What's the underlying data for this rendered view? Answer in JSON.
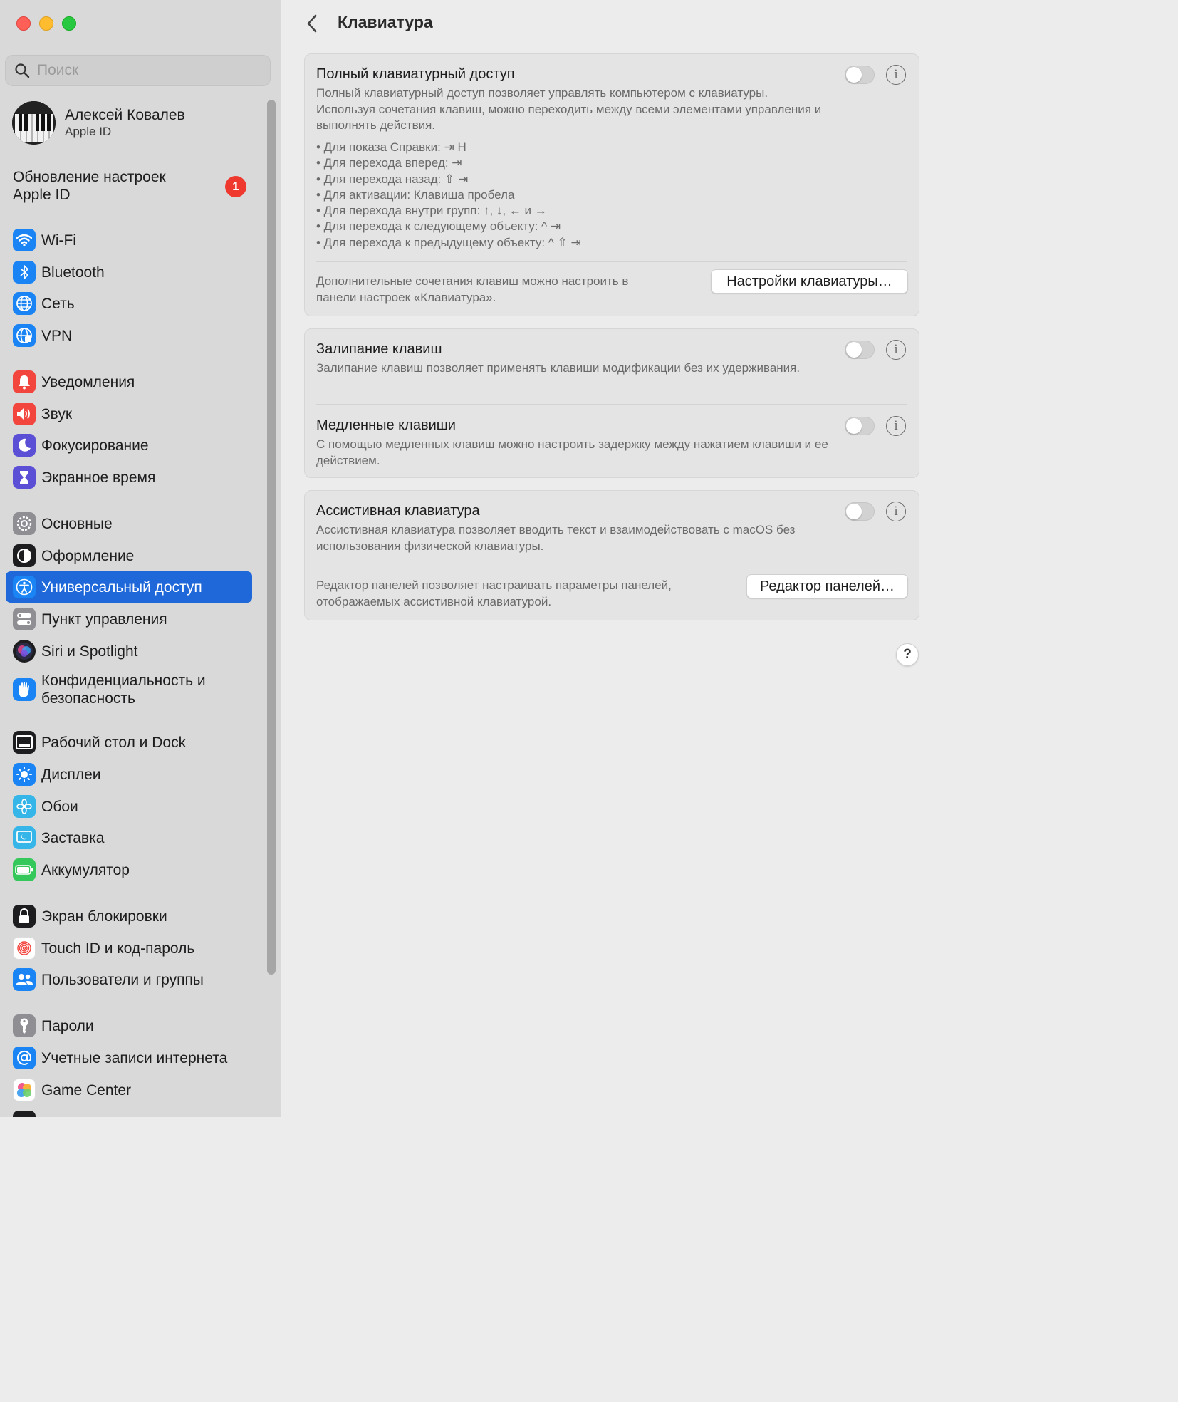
{
  "window": {
    "controls": [
      "close",
      "minimize",
      "maximize"
    ]
  },
  "sidebar": {
    "search_placeholder": "Поиск",
    "user": {
      "name": "Алексей Ковалев",
      "subtitle": "Apple ID"
    },
    "update": {
      "label": "Обновление настроек Apple ID",
      "badge": "1"
    },
    "items": [
      {
        "label": "Wi-Fi",
        "icon": "wifi-icon",
        "color": "#1a84f5"
      },
      {
        "label": "Bluetooth",
        "icon": "bluetooth-icon",
        "color": "#1a84f5"
      },
      {
        "label": "Сеть",
        "icon": "globe-icon",
        "color": "#1a84f5"
      },
      {
        "label": "VPN",
        "icon": "vpn-globe-icon",
        "color": "#1a84f5"
      },
      {
        "label": "Уведомления",
        "icon": "bell-icon",
        "color": "#f2453d"
      },
      {
        "label": "Звук",
        "icon": "speaker-icon",
        "color": "#f2453d"
      },
      {
        "label": "Фокусирование",
        "icon": "moon-icon",
        "color": "#5b4fd6"
      },
      {
        "label": "Экранное время",
        "icon": "hourglass-icon",
        "color": "#5b4fd6"
      },
      {
        "label": "Основные",
        "icon": "gear-icon",
        "color": "#8e8e93"
      },
      {
        "label": "Оформление",
        "icon": "appearance-icon",
        "color": "#1d1d1f"
      },
      {
        "label": "Универсальный доступ",
        "icon": "accessibility-icon",
        "color": "#1a84f5",
        "selected": true
      },
      {
        "label": "Пункт управления",
        "icon": "control-center-icon",
        "color": "#8e8e93"
      },
      {
        "label": "Siri и Spotlight",
        "icon": "siri-icon",
        "color": "#7b3fc4"
      },
      {
        "label": "Конфиденциальность и безопасность",
        "icon": "hand-icon",
        "color": "#1a84f5"
      },
      {
        "label": "Рабочий стол и Dock",
        "icon": "dock-icon",
        "color": "#1d1d1f"
      },
      {
        "label": "Дисплеи",
        "icon": "sun-icon",
        "color": "#1a84f5"
      },
      {
        "label": "Обои",
        "icon": "flower-icon",
        "color": "#35b5e8"
      },
      {
        "label": "Заставка",
        "icon": "screensaver-icon",
        "color": "#35b5e8"
      },
      {
        "label": "Аккумулятор",
        "icon": "battery-icon",
        "color": "#34c759"
      },
      {
        "label": "Экран блокировки",
        "icon": "lock-icon",
        "color": "#1d1d1f"
      },
      {
        "label": "Touch ID и код-пароль",
        "icon": "fingerprint-icon",
        "color": "#f2453d"
      },
      {
        "label": "Пользователи и группы",
        "icon": "users-icon",
        "color": "#1a84f5"
      },
      {
        "label": "Пароли",
        "icon": "key-icon",
        "color": "#8e8e93"
      },
      {
        "label": "Учетные записи интернета",
        "icon": "at-icon",
        "color": "#1a84f5"
      },
      {
        "label": "Game Center",
        "icon": "game-center-icon",
        "color": "#ffffff"
      }
    ]
  },
  "main": {
    "title": "Клавиатура",
    "full_keyboard_access": {
      "title": "Полный клавиатурный доступ",
      "description": "Полный клавиатурный доступ позволяет управлять компьютером с клавиатуры. Используя сочетания клавиш, можно переходить между всеми элементами управления и выполнять действия.",
      "enabled": false,
      "bullets": [
        "• Для показа Справки: ⇥ H",
        "• Для перехода вперед: ⇥",
        "• Для перехода назад: ⇧ ⇥",
        "• Для активации: Клавиша пробела",
        "• Для перехода внутри групп: ↑, ↓, ← и →",
        "• Для перехода к следующему объекту: ^ ⇥",
        "• Для перехода к предыдущему объекту: ^ ⇧ ⇥"
      ],
      "footer_text": "Дополнительные сочетания клавиш можно настроить в панели настроек «Клавиатура».",
      "button": "Настройки клавиатуры…"
    },
    "sticky_keys": {
      "title": "Залипание клавиш",
      "description": "Залипание клавиш позволяет применять клавиши модификации без их удерживания.",
      "enabled": false
    },
    "slow_keys": {
      "title": "Медленные клавиши",
      "description": "С помощью медленных клавиш можно настроить задержку между нажатием клавиши и ее действием.",
      "enabled": false
    },
    "assistive_keyboard": {
      "title": "Ассистивная клавиатура",
      "description": "Ассистивная клавиатура позволяет вводить текст и взаимодействовать с macOS без использования физической клавиатуры.",
      "enabled": false,
      "footer_text": "Редактор панелей позволяет настраивать параметры панелей, отображаемых ассистивной клавиатурой.",
      "button": "Редактор панелей…"
    },
    "help_label": "?",
    "info_glyph": "i"
  }
}
